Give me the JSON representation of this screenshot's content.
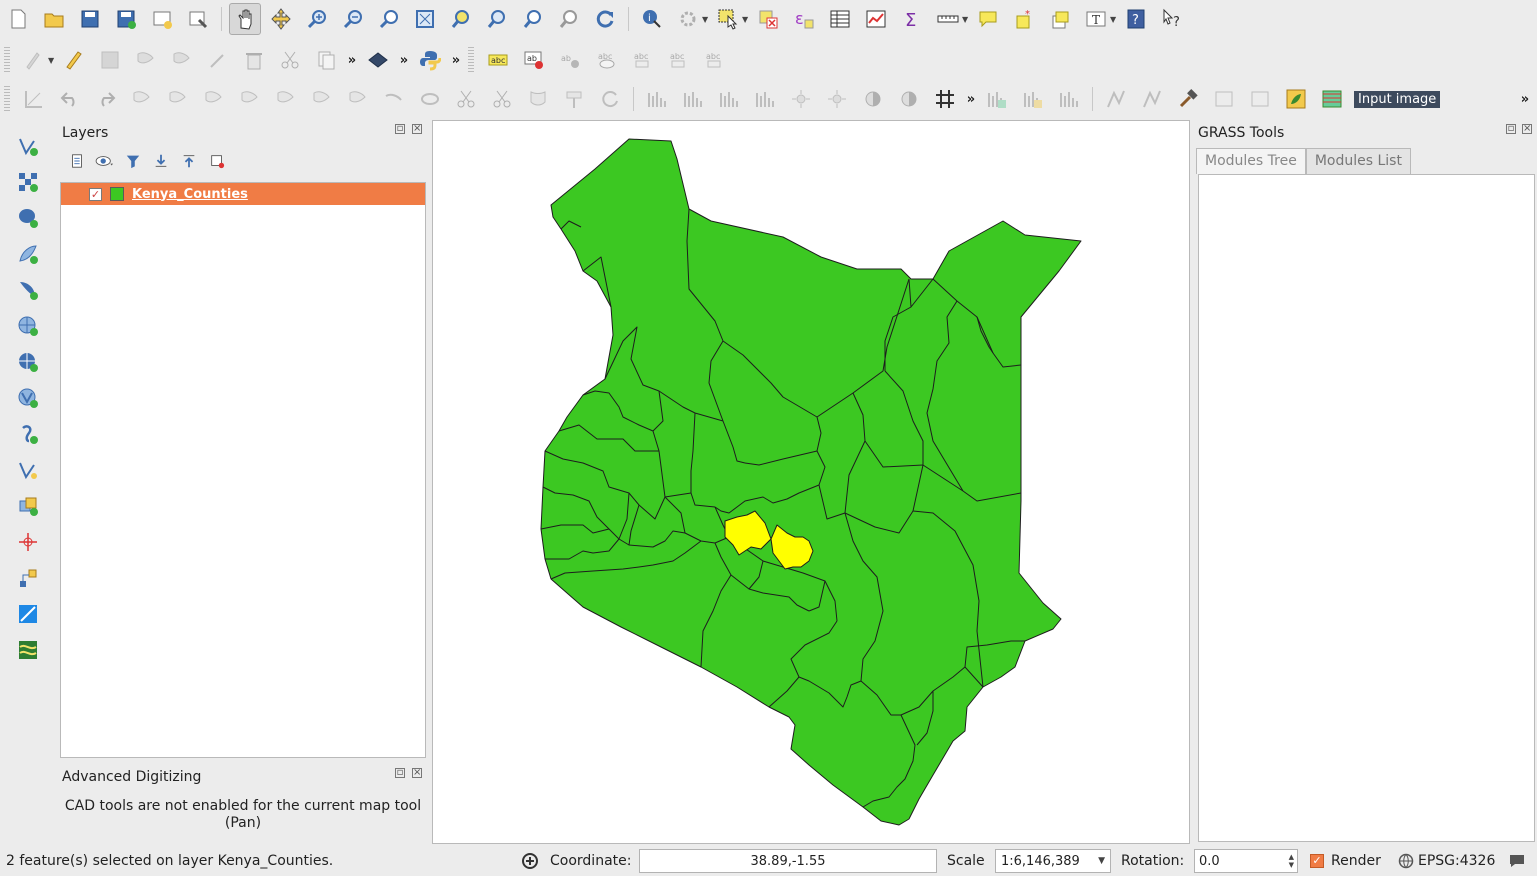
{
  "layers_panel": {
    "title": "Layers",
    "layers": [
      {
        "name": "Kenya_Counties",
        "checked": true,
        "fill_color": "#3cc822",
        "selected": true
      }
    ]
  },
  "advanced_digitizing": {
    "title": "Advanced Digitizing",
    "message": "CAD tools are not enabled for the current map tool (Pan)"
  },
  "grass_tools": {
    "title": "GRASS Tools",
    "tabs": [
      "Modules Tree",
      "Modules List"
    ],
    "active_tab": "Modules Tree"
  },
  "toolbar": {
    "input_image_label": "Input image",
    "active_tool": "pan-icon"
  },
  "map": {
    "layer": "Kenya_Counties",
    "feature_fill": "#3cc822",
    "selection_fill": "#ffff00"
  },
  "statusbar": {
    "message": "2 feature(s) selected on layer Kenya_Counties.",
    "coordinate_label": "Coordinate:",
    "coordinate_value": "38.89,-1.55",
    "scale_label": "Scale",
    "scale_value": "1:6,146,389",
    "rotation_label": "Rotation:",
    "rotation_value": "0.0",
    "render_label": "Render",
    "render_checked": true,
    "crs": "EPSG:4326"
  }
}
